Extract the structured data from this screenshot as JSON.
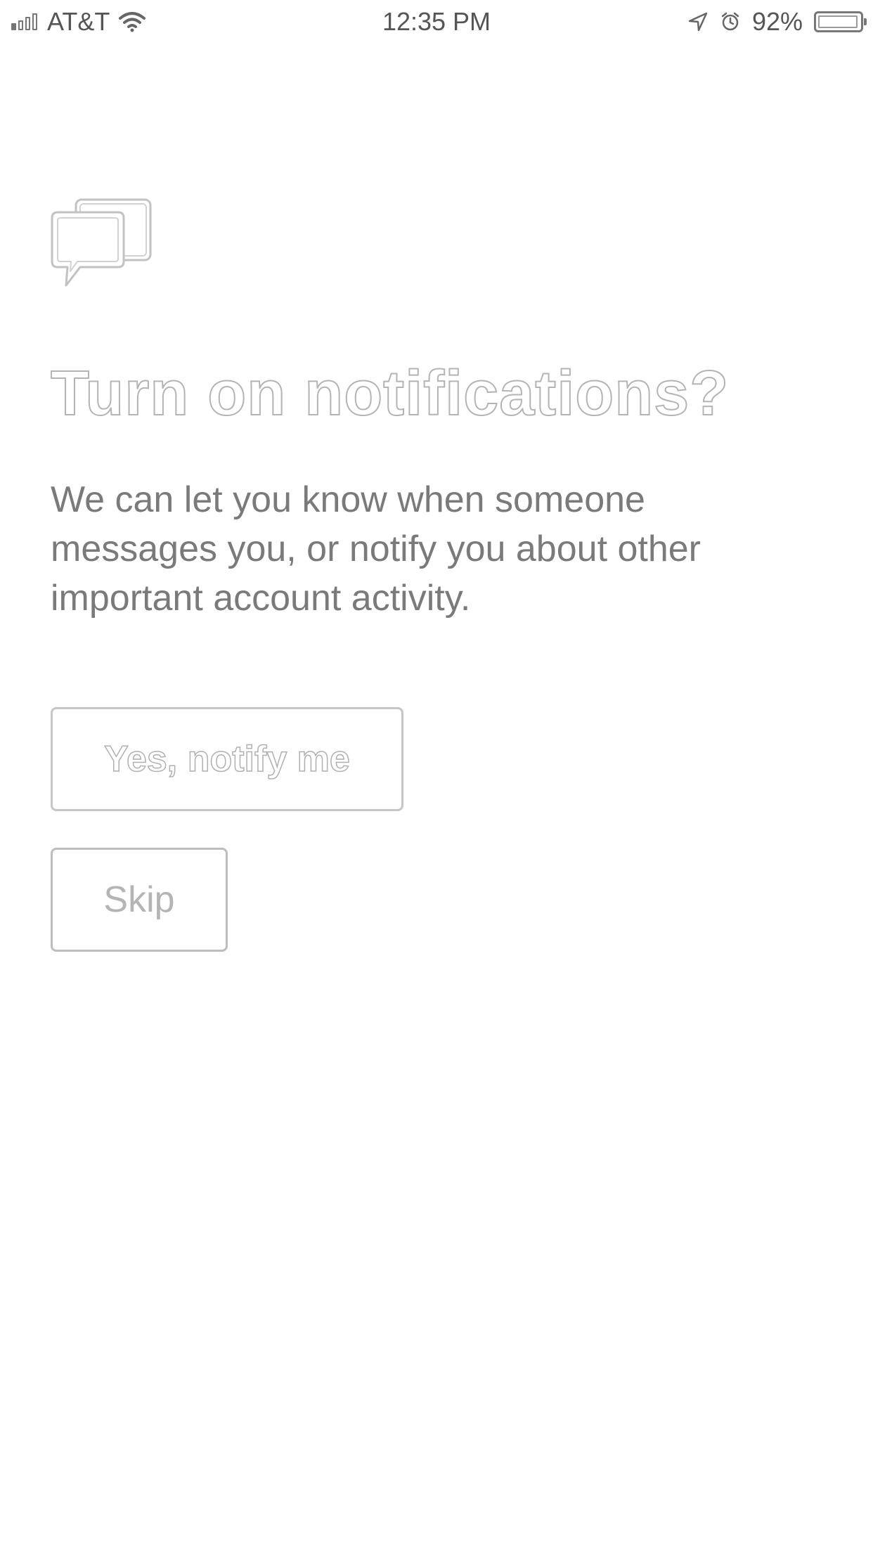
{
  "status_bar": {
    "carrier": "AT&T",
    "time": "12:35 PM",
    "battery_percent": "92%",
    "signal_bars_filled": 1,
    "signal_bars_total": 4,
    "icons": [
      "signal-icon",
      "wifi-icon",
      "location-arrow-icon",
      "alarm-icon",
      "battery-icon"
    ]
  },
  "prompt": {
    "icon": "chat-bubble-icon",
    "title": "Turn on notifications?",
    "body": "We can let you know when someone messages you, or notify you about other important account activity."
  },
  "actions": {
    "yes_label": "Yes, notify me",
    "skip_label": "Skip"
  },
  "colors": {
    "background": "#ffffff",
    "text": "#7a7a7a",
    "outline": "#c6c6c6"
  }
}
